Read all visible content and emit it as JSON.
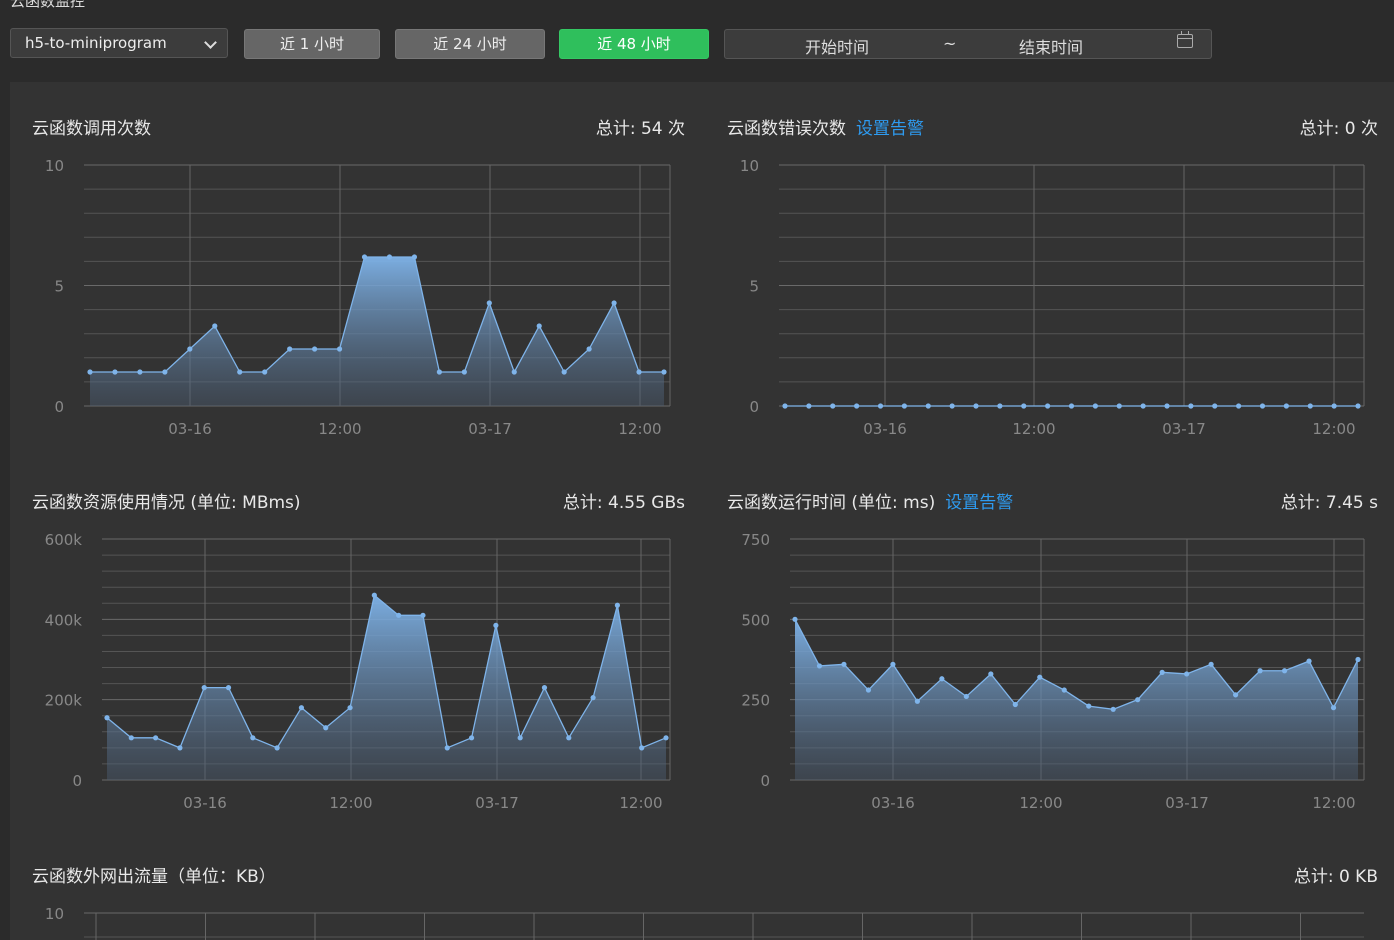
{
  "page_title": "云函数监控",
  "toolbar": {
    "function_select": "h5-to-miniprogram",
    "btn_1h": "近 1 小时",
    "btn_24h": "近 24 小时",
    "btn_48h": "近 48 小时",
    "start_placeholder": "开始时间",
    "range_sep": "~",
    "end_placeholder": "结束时间"
  },
  "colors": {
    "accent": "#2fbf5c",
    "link": "#2e9bf0",
    "line": "#7fb4ea"
  },
  "charts": {
    "invocations": {
      "title": "云函数调用次数",
      "total": "总计: 54 次"
    },
    "errors": {
      "title": "云函数错误次数",
      "alarm": "设置告警",
      "total": "总计: 0 次"
    },
    "resources": {
      "title": "云函数资源使用情况 (单位: MBms)",
      "total": "总计: 4.55 GBs"
    },
    "duration": {
      "title": "云函数运行时间 (单位: ms)",
      "alarm": "设置告警",
      "total": "总计: 7.45 s"
    },
    "traffic": {
      "title": "云函数外网出流量（单位：KB）",
      "total": "总计: 0 KB"
    }
  },
  "chart_data": [
    {
      "id": "invocations",
      "type": "area",
      "x_tick_labels": [
        "03-16",
        "12:00",
        "03-17",
        "12:00"
      ],
      "y_tick_labels": [
        "10",
        "5",
        "0"
      ],
      "ylim": [
        0,
        10
      ],
      "values": [
        1,
        1,
        1,
        1,
        2,
        3,
        1,
        1,
        2,
        2,
        2,
        6,
        6,
        6,
        1,
        1,
        4,
        1,
        3,
        1,
        2,
        4,
        1,
        1
      ]
    },
    {
      "id": "errors",
      "type": "area",
      "x_tick_labels": [
        "03-16",
        "12:00",
        "03-17",
        "12:00"
      ],
      "y_tick_labels": [
        "10",
        "5",
        "0"
      ],
      "ylim": [
        0,
        10
      ],
      "values": [
        0,
        0,
        0,
        0,
        0,
        0,
        0,
        0,
        0,
        0,
        0,
        0,
        0,
        0,
        0,
        0,
        0,
        0,
        0,
        0,
        0,
        0,
        0,
        0,
        0
      ]
    },
    {
      "id": "resources",
      "type": "area",
      "x_tick_labels": [
        "03-16",
        "12:00",
        "03-17",
        "12:00"
      ],
      "y_tick_labels": [
        "600k",
        "400k",
        "200k",
        "0"
      ],
      "ylim": [
        0,
        600000
      ],
      "values": [
        155000,
        105000,
        105000,
        80000,
        230000,
        230000,
        105000,
        80000,
        180000,
        130000,
        180000,
        460000,
        410000,
        410000,
        80000,
        105000,
        385000,
        105000,
        230000,
        105000,
        205000,
        435000,
        80000,
        105000
      ]
    },
    {
      "id": "duration",
      "type": "area",
      "x_tick_labels": [
        "03-16",
        "12:00",
        "03-17",
        "12:00"
      ],
      "y_tick_labels": [
        "750",
        "500",
        "250",
        "0"
      ],
      "ylim": [
        0,
        750
      ],
      "values": [
        500,
        355,
        360,
        280,
        360,
        245,
        315,
        260,
        330,
        235,
        320,
        280,
        230,
        220,
        250,
        335,
        330,
        360,
        265,
        340,
        340,
        370,
        225,
        375
      ]
    },
    {
      "id": "traffic",
      "type": "area",
      "y_tick_labels": [
        "10"
      ],
      "ylim": [
        0,
        10
      ]
    }
  ]
}
